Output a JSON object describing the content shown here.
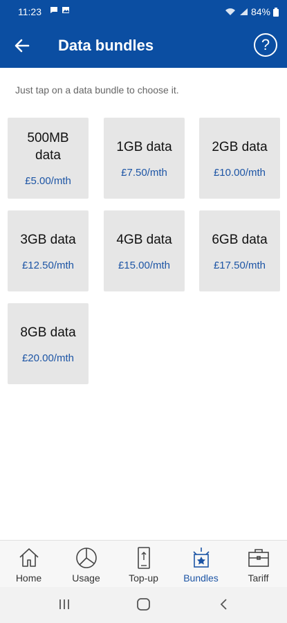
{
  "status_bar": {
    "time": "11:23",
    "battery": "84%"
  },
  "header": {
    "title": "Data bundles",
    "help_glyph": "?"
  },
  "hint": "Just tap on a data bundle to choose it.",
  "bundles": [
    {
      "name": "500MB data",
      "price": "£5.00/mth"
    },
    {
      "name": "1GB data",
      "price": "£7.50/mth"
    },
    {
      "name": "2GB data",
      "price": "£10.00/mth"
    },
    {
      "name": "3GB data",
      "price": "£12.50/mth"
    },
    {
      "name": "4GB data",
      "price": "£15.00/mth"
    },
    {
      "name": "6GB data",
      "price": "£17.50/mth"
    },
    {
      "name": "8GB data",
      "price": "£20.00/mth"
    }
  ],
  "bottom_nav": [
    {
      "label": "Home",
      "icon": "home-icon"
    },
    {
      "label": "Usage",
      "icon": "pie-chart-icon"
    },
    {
      "label": "Top-up",
      "icon": "phone-topup-icon"
    },
    {
      "label": "Bundles",
      "icon": "bundles-icon",
      "active": true
    },
    {
      "label": "Tariff",
      "icon": "briefcase-icon"
    }
  ],
  "colors": {
    "brand": "#0b4ea2",
    "price": "#1d55a5",
    "tile": "#e6e6e6"
  }
}
